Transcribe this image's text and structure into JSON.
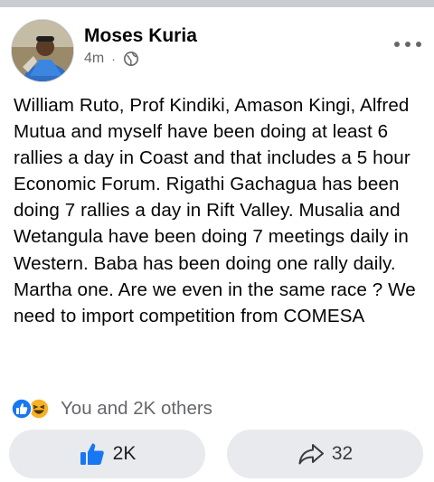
{
  "post": {
    "author": "Moses Kuria",
    "time": "4m",
    "separator": "·",
    "privacy_icon": "globe-icon",
    "more_icon": "more-horizontal-icon",
    "text": "William Ruto, Prof Kindiki, Amason Kingi, Alfred Mutua and myself have been doing at least 6 rallies a day in Coast and that includes a 5 hour Economic Forum. Rigathi Gachagua has been doing 7 rallies a day in Rift Valley. Musalia and Wetangula have been doing 7 meetings daily in Western. Baba has been doing one rally daily. Martha one.  Are we even in the same race ? We need to import competition from COMESA"
  },
  "reactions": {
    "icons": [
      "like-reaction-icon",
      "haha-reaction-icon"
    ],
    "summary": "You and 2K others"
  },
  "actions": {
    "like": {
      "icon": "thumbs-up-icon",
      "count": "2K"
    },
    "share": {
      "icon": "share-arrow-icon",
      "count": "32"
    }
  },
  "colors": {
    "brand_blue": "#1877f2",
    "muted_text": "#65676b",
    "pill_bg": "#e8eaed",
    "haha_yellow": "#f7b125"
  }
}
